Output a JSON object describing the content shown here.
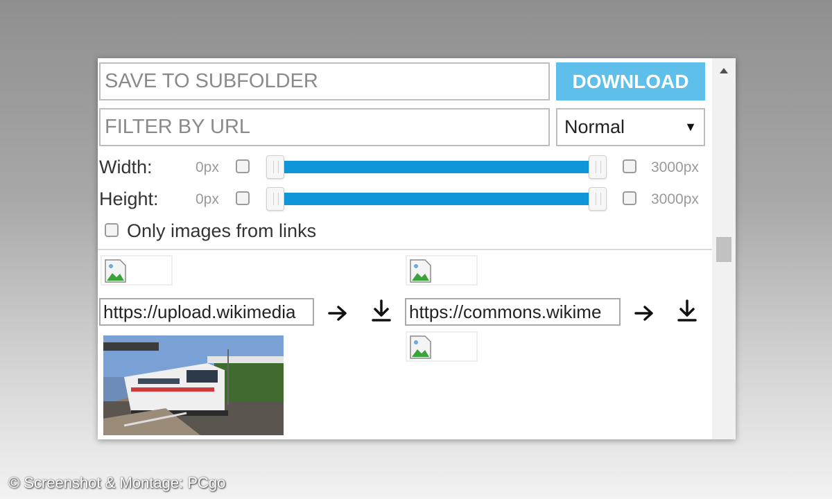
{
  "toolbar": {
    "subfolder_placeholder": "SAVE TO SUBFOLDER",
    "download_label": "DOWNLOAD",
    "filter_placeholder": "FILTER BY URL",
    "filter_mode": "Normal"
  },
  "filters": {
    "width": {
      "label": "Width:",
      "min": "0px",
      "max": "3000px",
      "range": [
        0,
        3000
      ]
    },
    "height": {
      "label": "Height:",
      "min": "0px",
      "max": "3000px",
      "range": [
        0,
        3000
      ]
    },
    "only_links_label": "Only images from links"
  },
  "results": [
    {
      "url": "https://upload.wikimedia"
    },
    {
      "url": "https://commons.wikime"
    }
  ],
  "colors": {
    "accent": "#5ec0ea",
    "slider": "#0e96d8"
  },
  "icons": [
    "broken-image-icon",
    "arrow-right-icon",
    "download-icon",
    "chevron-up-icon"
  ],
  "credit": "© Screenshot & Montage: PCgo"
}
